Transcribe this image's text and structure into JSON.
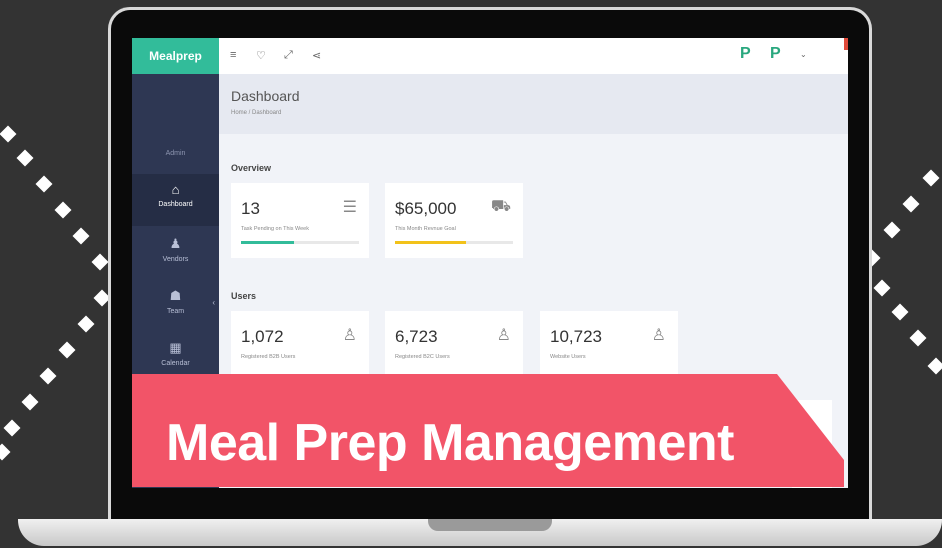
{
  "app": {
    "brand": "Mealprep"
  },
  "topbar": {
    "icons": [
      "menu-icon",
      "bulb-icon",
      "expand-icon",
      "share-icon"
    ],
    "right_icons": [
      "p-badge-icon",
      "p-badge-icon"
    ]
  },
  "sidebar": {
    "user": "Admin",
    "items": [
      {
        "label": "Dashboard",
        "icon": "home-icon",
        "active": true
      },
      {
        "label": "Vendors",
        "icon": "user-icon",
        "active": false
      },
      {
        "label": "Team",
        "icon": "team-icon",
        "active": false
      },
      {
        "label": "Calendar",
        "icon": "calendar-icon",
        "active": false
      }
    ]
  },
  "header": {
    "title": "Dashboard",
    "breadcrumb": "Home / Dashboard"
  },
  "overview": {
    "title": "Overview",
    "cards": [
      {
        "value": "13",
        "label": "Task Pending on This Week",
        "icon": "list-icon",
        "progress": 0.45,
        "color": "#32bc9a"
      },
      {
        "value": "$65,000",
        "label": "This Month Revnue Goal",
        "icon": "cart-icon",
        "progress": 0.6,
        "color": "#f2c21a"
      }
    ]
  },
  "users": {
    "title": "Users",
    "cards": [
      {
        "value": "1,072",
        "label": "Registered B2B Users",
        "icon": "user-outline-icon"
      },
      {
        "value": "6,723",
        "label": "Registered B2C Users",
        "icon": "user-outline-icon"
      },
      {
        "value": "10,723",
        "label": "Website Users",
        "icon": "user-outline-icon"
      }
    ]
  },
  "banner": {
    "text": "Meal Prep Management"
  },
  "colors": {
    "brand": "#32bc9a",
    "sidebar": "#2e3753",
    "banner": "#f25468",
    "accent_yellow": "#f2c21a"
  }
}
